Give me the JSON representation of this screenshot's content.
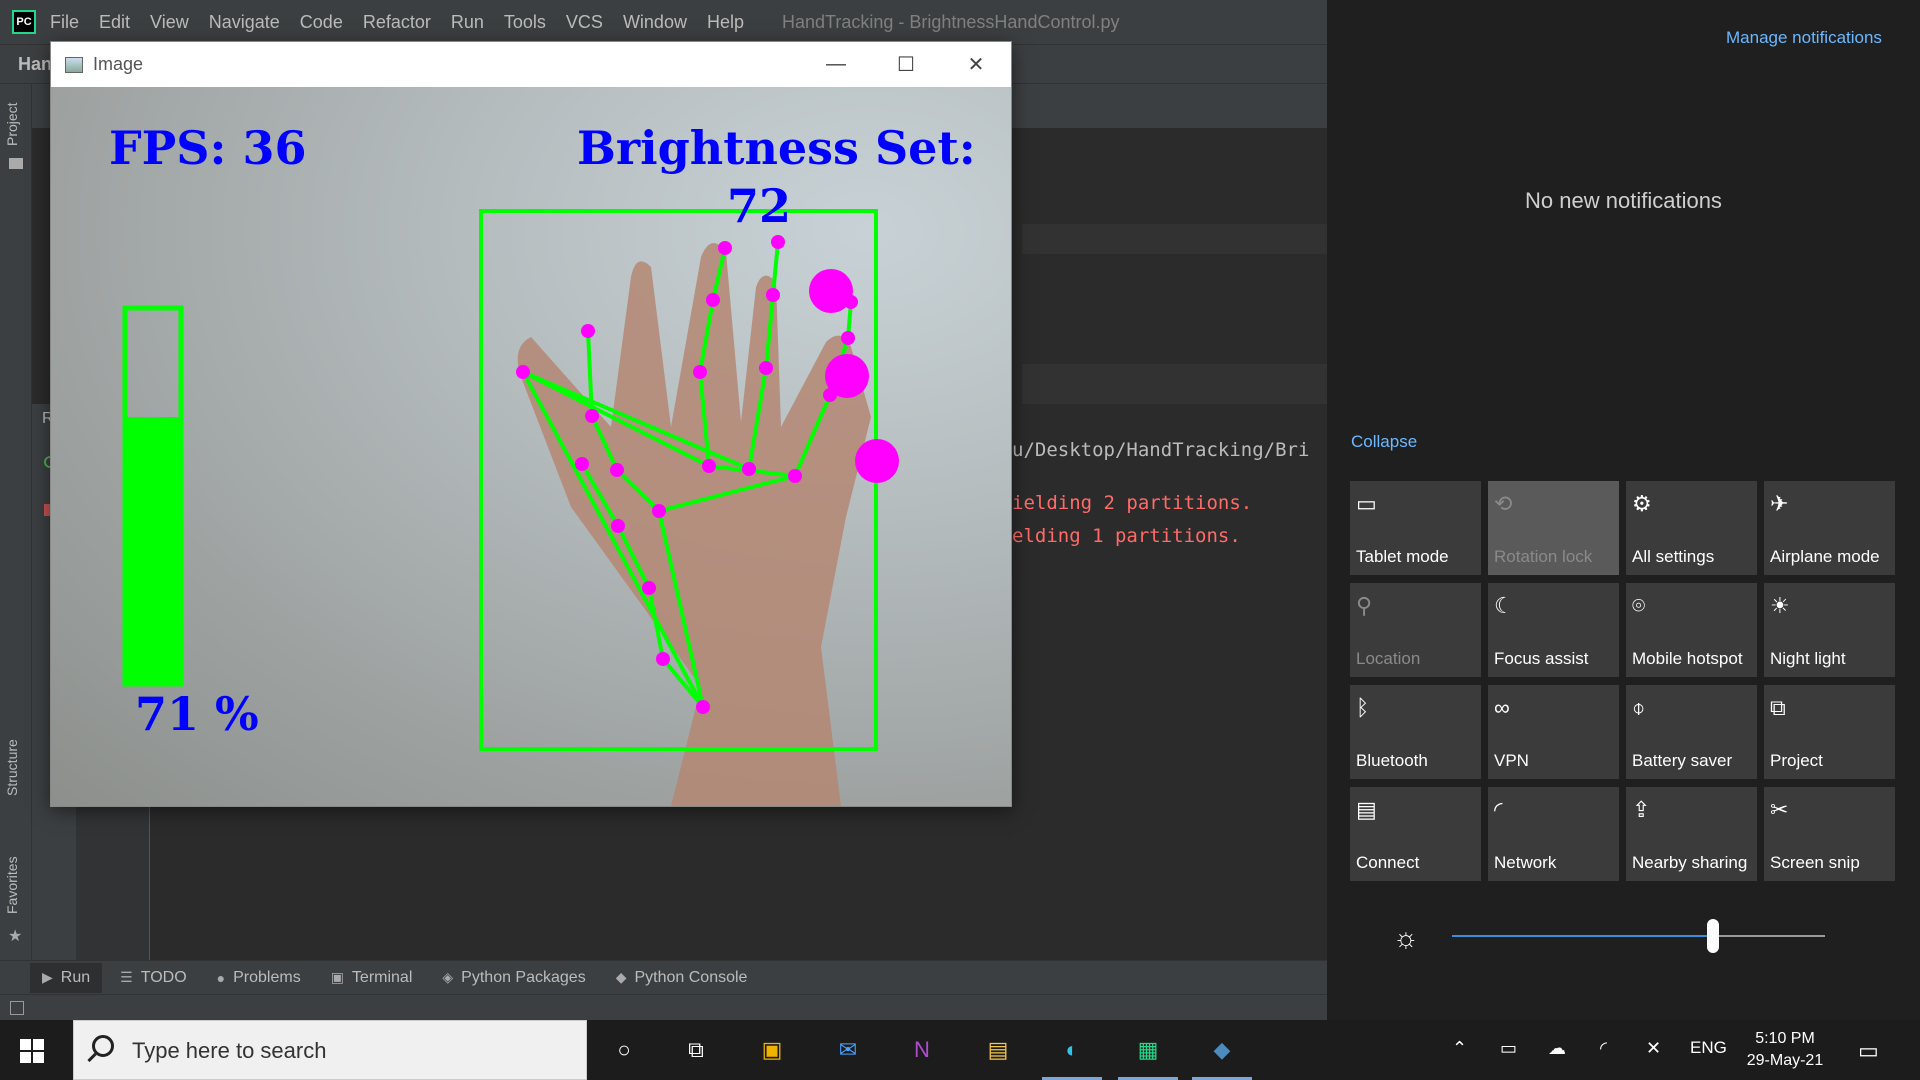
{
  "ide": {
    "menu": [
      "File",
      "Edit",
      "View",
      "Navigate",
      "Code",
      "Refactor",
      "Run",
      "Tools",
      "VCS",
      "Window",
      "Help"
    ],
    "window_title": "HandTracking - BrightnessHandControl.py",
    "breadcrumb": "Han",
    "left_tabs": [
      "Project",
      "Structure",
      "Favorites"
    ],
    "run_label": "R",
    "console_lines": [
      {
        "text": "u/Desktop/HandTracking/Bri",
        "color": "#bbbbbb"
      },
      {
        "text": "ielding 2 partitions.",
        "color": "#ff6b68"
      },
      {
        "text": "elding 1 partitions.",
        "color": "#ff6b68"
      }
    ],
    "bottom_tabs": [
      "Run",
      "TODO",
      "Problems",
      "Terminal",
      "Python Packages",
      "Python Console"
    ]
  },
  "image_window": {
    "title": "Image",
    "fps_text": "FPS: 36",
    "brightness_label": "Brightness Set:",
    "brightness_value": "72",
    "volume_percent_text": "71 %",
    "volume_level": 0.71,
    "colors": {
      "bar": "#00ff00",
      "text": "#0000ff",
      "landmark": "#ff00ff",
      "box": "#00ff00"
    }
  },
  "action_center": {
    "manage": "Manage notifications",
    "empty": "No new notifications",
    "collapse": "Collapse",
    "tiles": [
      {
        "label": "Tablet mode",
        "icon": "tablet-icon",
        "state": "normal"
      },
      {
        "label": "Rotation lock",
        "icon": "rotation-lock-icon",
        "state": "pressed-disabled"
      },
      {
        "label": "All settings",
        "icon": "gear-icon",
        "state": "normal"
      },
      {
        "label": "Airplane mode",
        "icon": "airplane-icon",
        "state": "normal"
      },
      {
        "label": "Location",
        "icon": "location-icon",
        "state": "disabled"
      },
      {
        "label": "Focus assist",
        "icon": "moon-icon",
        "state": "normal"
      },
      {
        "label": "Mobile hotspot",
        "icon": "hotspot-icon",
        "state": "normal"
      },
      {
        "label": "Night light",
        "icon": "night-light-icon",
        "state": "normal"
      },
      {
        "label": "Bluetooth",
        "icon": "bluetooth-icon",
        "state": "normal"
      },
      {
        "label": "VPN",
        "icon": "vpn-icon",
        "state": "normal"
      },
      {
        "label": "Battery saver",
        "icon": "battery-saver-icon",
        "state": "normal"
      },
      {
        "label": "Project",
        "icon": "project-icon",
        "state": "normal"
      },
      {
        "label": "Connect",
        "icon": "connect-icon",
        "state": "normal"
      },
      {
        "label": "Network",
        "icon": "network-icon",
        "state": "normal"
      },
      {
        "label": "Nearby sharing",
        "icon": "nearby-sharing-icon",
        "state": "normal"
      },
      {
        "label": "Screen snip",
        "icon": "screen-snip-icon",
        "state": "normal"
      }
    ],
    "brightness_level": 0.7
  },
  "taskbar": {
    "search_placeholder": "Type here to search",
    "language": "ENG",
    "time": "5:10 PM",
    "date": "29-May-21"
  }
}
